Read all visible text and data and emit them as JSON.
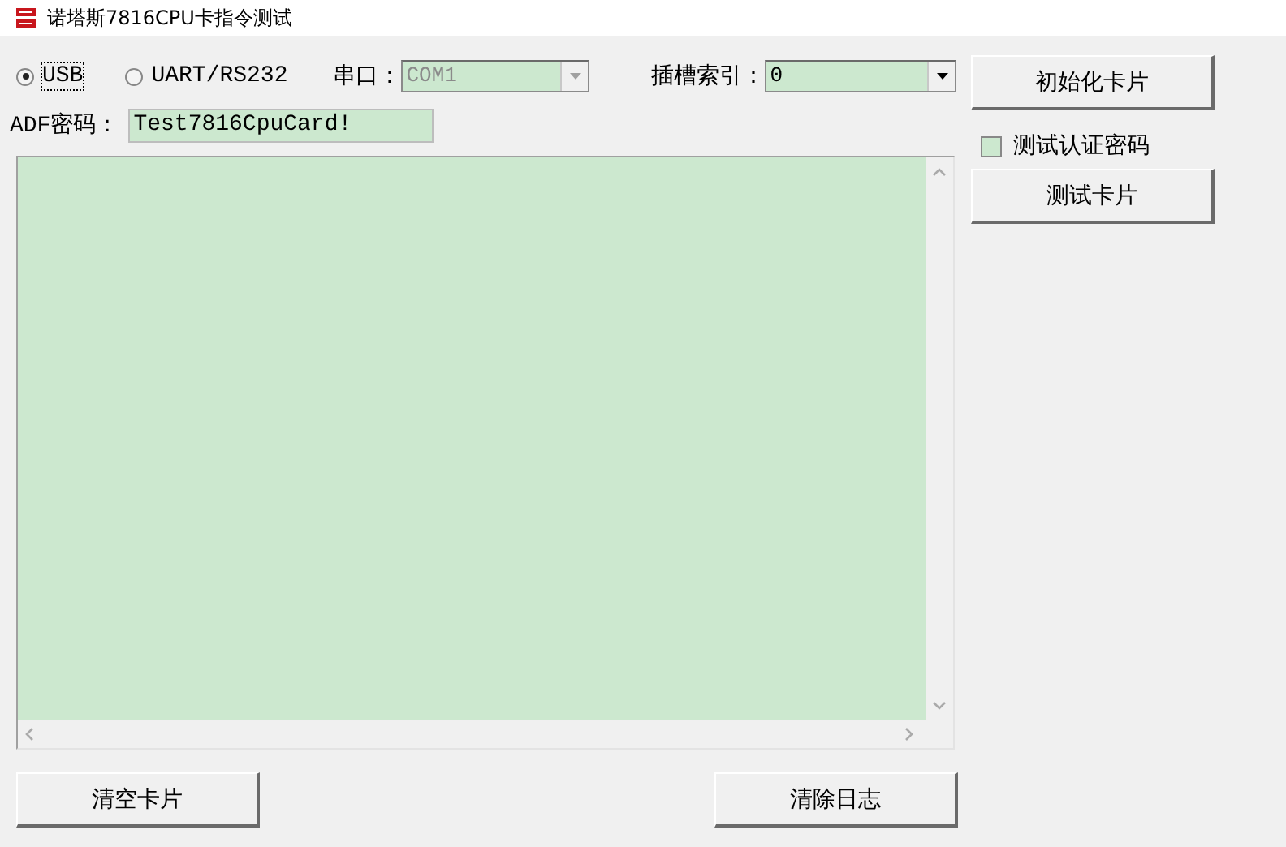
{
  "window": {
    "title": "诺塔斯7816CPU卡指令测试"
  },
  "connection": [
    {
      "label": "USB",
      "selected": true
    },
    {
      "label": "UART/RS232",
      "selected": false
    }
  ],
  "port": {
    "label": "串口：",
    "value": "COM1",
    "disabled": true
  },
  "slot": {
    "label": "插槽索引：",
    "value": "0",
    "disabled": false
  },
  "adf": {
    "label": "ADF密码：",
    "value": "Test7816CpuCard!"
  },
  "init_button": "初始化卡片",
  "verify_checkbox": {
    "label": "测试认证密码",
    "checked": false
  },
  "test_button": "测试卡片",
  "clear_card_button": "清空卡片",
  "clear_log_button": "清除日志"
}
